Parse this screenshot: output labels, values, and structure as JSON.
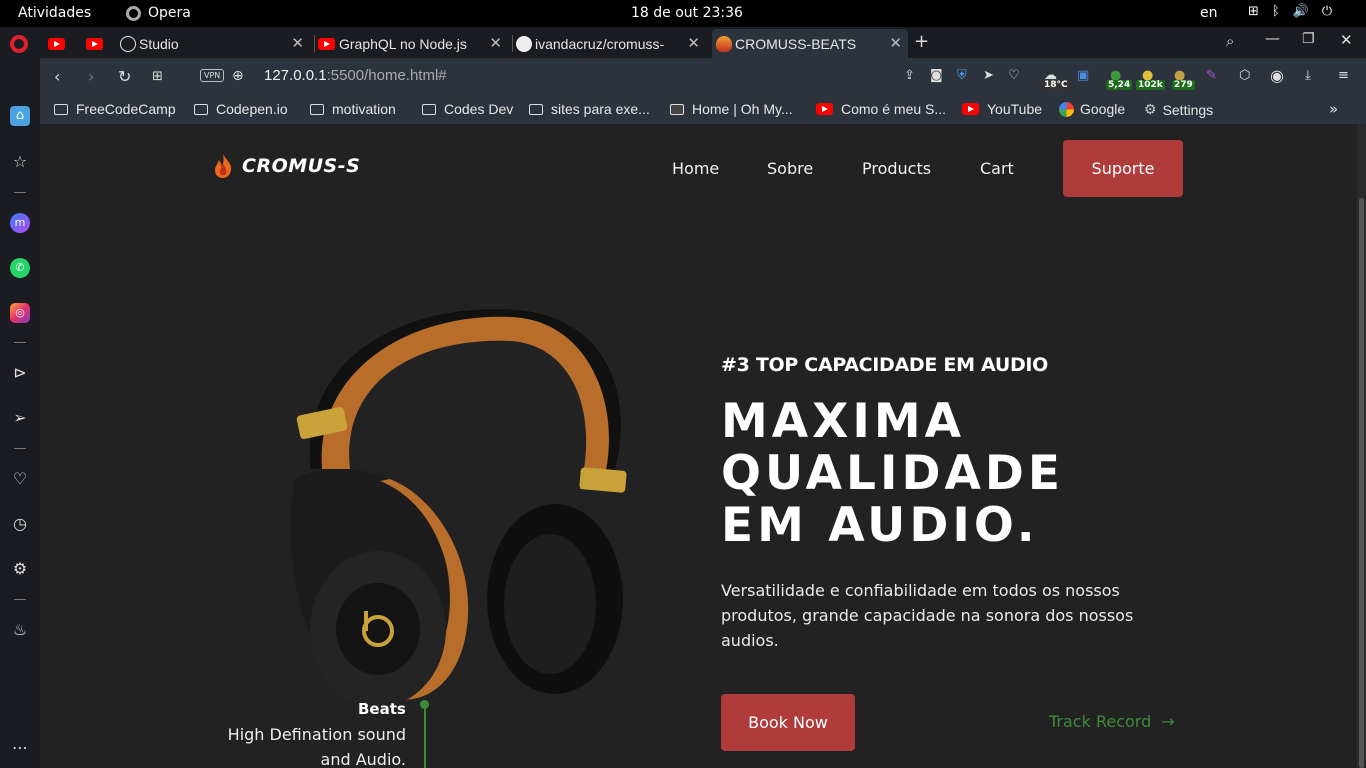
{
  "system": {
    "activities": "Atividades",
    "app_name": "Opera",
    "clock": "18 de out  23:36",
    "lang": "en"
  },
  "tabs": [
    {
      "label": ""
    },
    {
      "label": ""
    },
    {
      "label": "Studio"
    },
    {
      "label": "GraphQL no Node.js"
    },
    {
      "label": "ivandacruz/cromuss-"
    },
    {
      "label": "CROMUSS-BEATS"
    }
  ],
  "address": {
    "vpn": "VPN",
    "host": "127.0.0.1",
    "rest": ":5500/home.html#"
  },
  "extensions": {
    "weather": "18°C",
    "b1": "5,24",
    "b2": "102k",
    "b3": "279"
  },
  "bookmarks": [
    {
      "label": "FreeCodeCamp"
    },
    {
      "label": "Codepen.io"
    },
    {
      "label": "motivation"
    },
    {
      "label": "Codes Dev"
    },
    {
      "label": "sites para exe..."
    },
    {
      "label": "Home | Oh My..."
    },
    {
      "label": "Como é meu S..."
    },
    {
      "label": "YouTube"
    },
    {
      "label": "Google"
    },
    {
      "label": "Settings"
    }
  ],
  "site": {
    "logo": "CROMUS-S",
    "nav": [
      "Home",
      "Sobre",
      "Products",
      "Cart"
    ],
    "support": "Suporte",
    "tagline": "#3 TOP CAPACIDADE EM AUDIO",
    "headline": [
      "MAXIMA",
      "QUALIDADE",
      "EM AUDIO."
    ],
    "description": "Versatilidade e confiabilidade em todos os nossos produtos, grande capacidade na sonora dos nossos audios.",
    "book_now": "Book Now",
    "track_record": "Track Record",
    "callout_title": "Beats",
    "callout_text": "High Defination sound and Audio."
  },
  "colors": {
    "accent": "#b03b3b",
    "green": "#3c8a3c",
    "page_bg": "#222222"
  }
}
